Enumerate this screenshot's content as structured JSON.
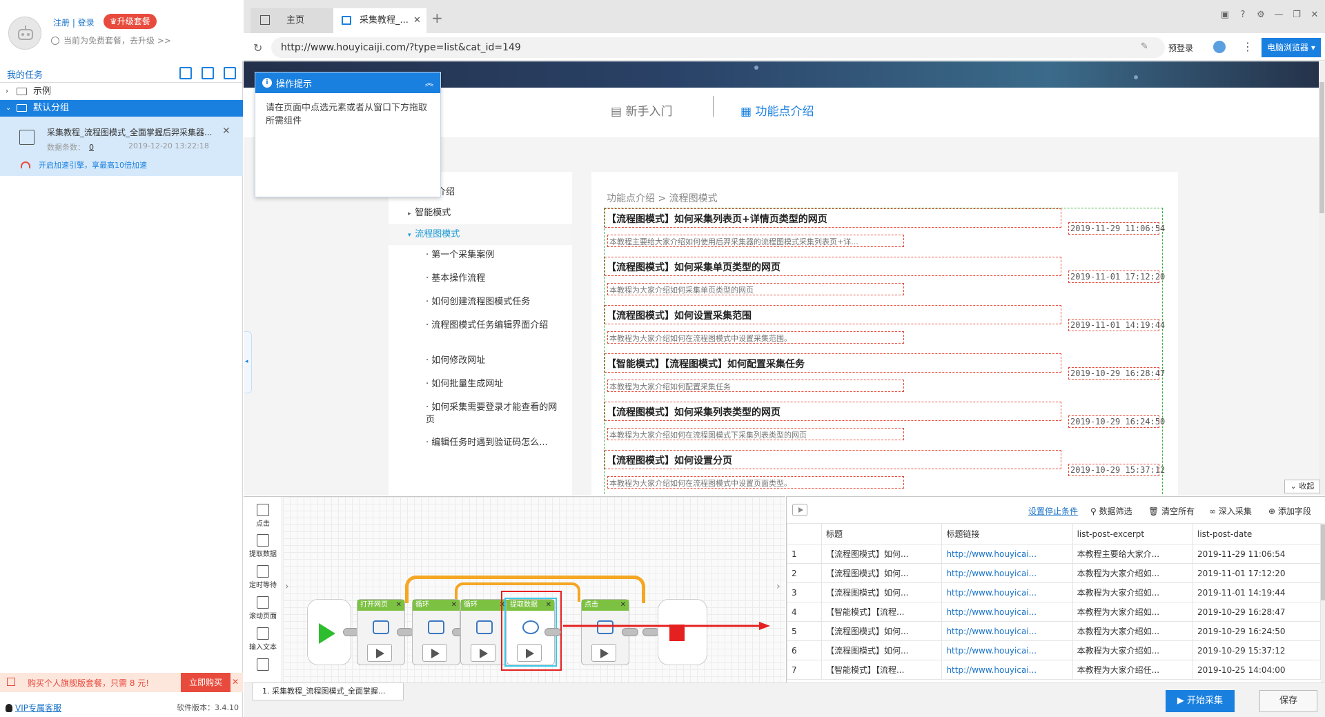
{
  "user": {
    "login": "注册 | 登录",
    "upgrade": "♛升级套餐",
    "free_note": "当前为免费套餐，去升级 >>"
  },
  "tasks": {
    "header": "我的任务",
    "tree": [
      {
        "label": "示例",
        "arrow": "›"
      },
      {
        "label": "默认分组",
        "arrow": "⌄"
      }
    ],
    "item": {
      "title": "采集教程_流程图模式_全面掌握后羿采集器...",
      "count_label": "数据条数：",
      "count": "0",
      "date": "2019-12-20 13:22:18",
      "speed": "开启加速引擎，享最高10倍加速"
    }
  },
  "promo": {
    "text": "购买个人旗舰版套餐，只需 8 元!",
    "buy": "立即购买",
    "close": "✕"
  },
  "footer": {
    "vip": "VIP专属客服",
    "version": "软件版本：3.4.10"
  },
  "browser": {
    "tabs": [
      {
        "label": "主页"
      },
      {
        "label": "采集教程_..."
      }
    ],
    "url": "http://www.houyicaiji.com/?type=list&cat_id=149",
    "prelogin": "预登录",
    "browser_btn": "电脑浏览器 ▾"
  },
  "page": {
    "nav": {
      "beginner": "新手入门",
      "feature": "功能点介绍"
    },
    "side_menu": [
      {
        "label": "介绍"
      },
      {
        "label": "智能模式"
      },
      {
        "label": "流程图模式"
      },
      {
        "label": "第一个采集案例"
      },
      {
        "label": "基本操作流程"
      },
      {
        "label": "如何创建流程图模式任务"
      },
      {
        "label": "流程图模式任务编辑界面介绍"
      },
      {
        "label": "如何修改网址"
      },
      {
        "label": "如何批量生成网址"
      },
      {
        "label": "如何采集需要登录才能查看的网页"
      },
      {
        "label": "编辑任务时遇到验证码怎么..."
      }
    ],
    "breadcrumb": "功能点介绍 > 流程图模式",
    "articles": [
      {
        "title": "【流程图模式】如何采集列表页+详情页类型的网页",
        "date": "2019-11-29 11:06:54",
        "desc": "本教程主要给大家介绍如何使用后羿采集器的流程图模式采集列表页+详..."
      },
      {
        "title": "【流程图模式】如何采集单页类型的网页",
        "date": "2019-11-01 17:12:20",
        "desc": "本教程为大家介绍如何采集单页类型的网页"
      },
      {
        "title": "【流程图模式】如何设置采集范围",
        "date": "2019-11-01 14:19:44",
        "desc": "本教程为大家介绍如何在流程图模式中设置采集范围。"
      },
      {
        "title": "【智能模式】【流程图模式】如何配置采集任务",
        "date": "2019-10-29 16:28:47",
        "desc": "本教程为大家介绍如何配置采集任务"
      },
      {
        "title": "【流程图模式】如何采集列表类型的网页",
        "date": "2019-10-29 16:24:50",
        "desc": "本教程为大家介绍如何在流程图模式下采集列表类型的网页"
      },
      {
        "title": "【流程图模式】如何设置分页",
        "date": "2019-10-29 15:37:12",
        "desc": "本教程为大家介绍如何在流程图模式中设置页面类型。"
      }
    ],
    "collapse": "⌄ 收起"
  },
  "tip": {
    "title": "操作提示",
    "body": "请在页面中点选元素或者从窗口下方拖取所需组件"
  },
  "tools": [
    {
      "label": "点击"
    },
    {
      "label": "提取数据"
    },
    {
      "label": "定时等待"
    },
    {
      "label": "滚动页面"
    },
    {
      "label": "输入文本"
    }
  ],
  "workflow": {
    "nodes": [
      {
        "label": "打开网页"
      },
      {
        "label": "循环"
      },
      {
        "label": "循环"
      },
      {
        "label": "提取数据"
      },
      {
        "label": "点击"
      }
    ],
    "tab": "1. 采集教程_流程图模式_全面掌握..."
  },
  "data_panel": {
    "actions": {
      "stop": "设置停止条件",
      "filter": "数据筛选",
      "clear": "清空所有",
      "deep": "深入采集",
      "add_field": "添加字段"
    },
    "columns": [
      "",
      "标题",
      "标题链接",
      "list-post-excerpt",
      "list-post-date"
    ],
    "rows": [
      [
        "1",
        "【流程图模式】如何...",
        "http://www.houyicai...",
        "本教程主要给大家介...",
        "2019-11-29 11:06:54"
      ],
      [
        "2",
        "【流程图模式】如何...",
        "http://www.houyicai...",
        "本教程为大家介绍如...",
        "2019-11-01 17:12:20"
      ],
      [
        "3",
        "【流程图模式】如何...",
        "http://www.houyicai...",
        "本教程为大家介绍如...",
        "2019-11-01 14:19:44"
      ],
      [
        "4",
        "【智能模式】【流程...",
        "http://www.houyicai...",
        "本教程为大家介绍如...",
        "2019-10-29 16:28:47"
      ],
      [
        "5",
        "【流程图模式】如何...",
        "http://www.houyicai...",
        "本教程为大家介绍如...",
        "2019-10-29 16:24:50"
      ],
      [
        "6",
        "【流程图模式】如何...",
        "http://www.houyicai...",
        "本教程为大家介绍如...",
        "2019-10-29 15:37:12"
      ],
      [
        "7",
        "【智能模式】【流程...",
        "http://www.houyicai...",
        "本教程为大家介绍任...",
        "2019-10-25 14:04:00"
      ]
    ]
  },
  "bottom": {
    "start": "▶ 开始采集",
    "save": "保存"
  }
}
